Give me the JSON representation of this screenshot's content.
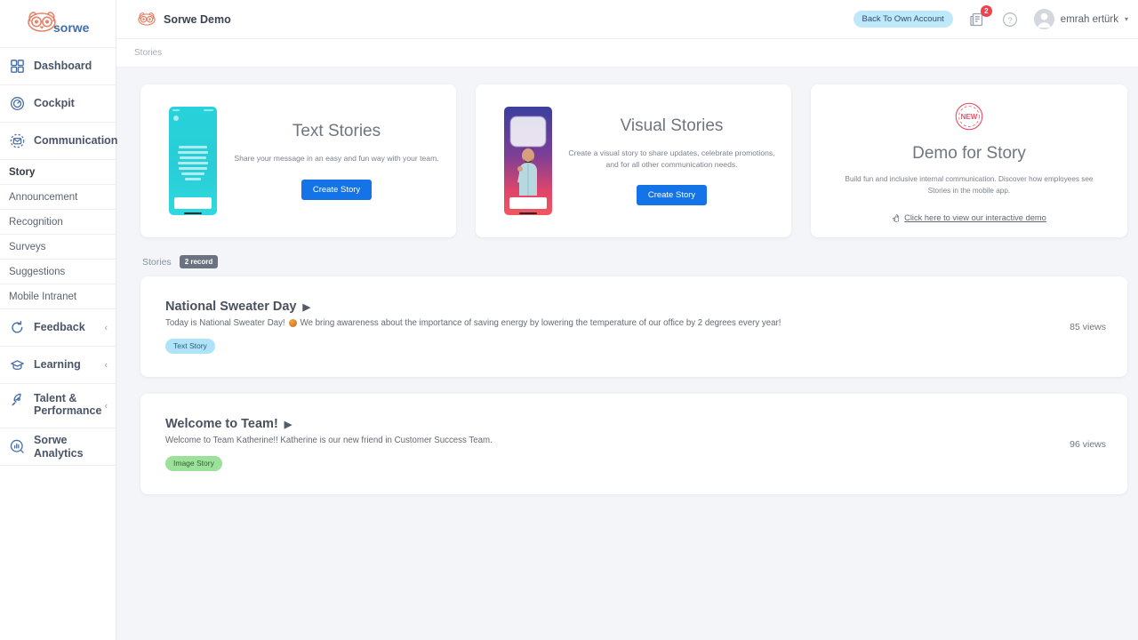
{
  "sidebar": {
    "logo_text": "sorwe",
    "logo_icon": "owl-logo-icon",
    "main_items": [
      {
        "label": "Dashboard",
        "icon": "grid-dashboard-icon",
        "chevron": ""
      },
      {
        "label": "Cockpit",
        "icon": "cockpit-target-icon",
        "chevron": ""
      },
      {
        "label": "Communication",
        "icon": "communication-mail-icon",
        "chevron": "⌄"
      }
    ],
    "sub_items": [
      {
        "label": "Story",
        "active": true
      },
      {
        "label": "Announcement",
        "active": false
      },
      {
        "label": "Recognition",
        "active": false
      },
      {
        "label": "Surveys",
        "active": false
      },
      {
        "label": "Suggestions",
        "active": false
      },
      {
        "label": "Mobile Intranet",
        "active": false
      }
    ],
    "bottom_items": [
      {
        "label": "Feedback",
        "icon": "feedback-refresh-icon",
        "chevron": "‹"
      },
      {
        "label": "Learning",
        "icon": "learning-graduation-cap-icon",
        "chevron": "‹"
      },
      {
        "label": "Talent & Performance",
        "icon": "talent-rocket-icon",
        "chevron": "‹"
      },
      {
        "label": "Sorwe Analytics",
        "icon": "analytics-chart-icon",
        "chevron": ""
      }
    ]
  },
  "topbar": {
    "brand_name": "Sorwe Demo",
    "brand_icon": "owl-logo-icon",
    "back_to_own_account": "Back To Own Account",
    "news_icon": "news-document-icon",
    "news_badge": "2",
    "help_icon": "help-question-icon",
    "avatar_icon": "user-avatar-icon",
    "user_name": "emrah ertürk",
    "caret_icon": "chevron-down-icon"
  },
  "breadcrumb": {
    "current": "Stories"
  },
  "cards": [
    {
      "title": "Text Stories",
      "desc": "Share your message in an easy and fun way with your team.",
      "button": "Create Story",
      "preview_icon": "text-story-phone-preview"
    },
    {
      "title": "Visual Stories",
      "desc": "Create a visual story to share updates, celebrate promotions, and for all other communication needs.",
      "button": "Create Story",
      "preview_icon": "visual-story-phone-preview"
    },
    {
      "badge": "NEW",
      "title": "Demo for Story",
      "desc": "Build fun and inclusive internal communication. Discover how employees see Stories in the mobile app.",
      "link": "Click here to view our interactive demo",
      "link_icon": "pointing-hand-icon"
    }
  ],
  "stories_section": {
    "label": "Stories",
    "record_count": "2 record",
    "items": [
      {
        "title": "National Sweater Day",
        "play_icon": "play-triangle-icon",
        "desc_before": "Today is National Sweater Day!",
        "emoji_icon": "sweater-emoji-icon",
        "desc_after": "We bring awareness about the importance of saving energy by lowering the temperature of our office by 2 degrees every year!",
        "tag": "Text Story",
        "tag_type": "text-story",
        "views": "85 views"
      },
      {
        "title": "Welcome to Team!",
        "play_icon": "play-triangle-icon",
        "desc_before": "Welcome to Team Katherine!! Katherine is our new friend in Customer Success Team.",
        "emoji_icon": "",
        "desc_after": "",
        "tag": "Image Story",
        "tag_type": "image-story",
        "views": "96 views"
      }
    ]
  },
  "colors": {
    "accent_blue": "#1473e6",
    "logo_orange": "#e4856b",
    "logo_blue": "#3f6ea8",
    "badge_red": "#f0414f",
    "pill_blue": "#bfe8fb",
    "tag_text_story": "#aee3fa",
    "tag_image_story": "#9be19a",
    "new_stamp_red": "#e8536a",
    "page_bg": "#f4f5f8"
  }
}
